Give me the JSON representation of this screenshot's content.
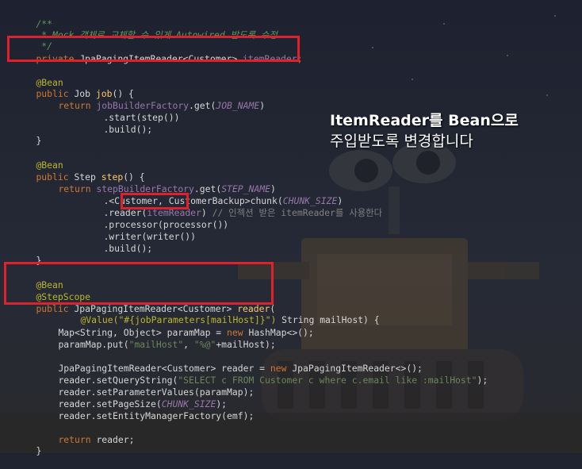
{
  "code": {
    "comment_open": "/**",
    "comment_body_star": " * ",
    "comment_body_text": "Mock 객체로 교체할 수 있게 Autowired 받도록 수정",
    "comment_close": " */",
    "field_private": "private",
    "field_type": " JpaPagingItemReader<Customer> ",
    "field_name": "itemReader",
    "field_semicolon": ";",
    "bean1": "@Bean",
    "job_public": "public",
    "job_type": " Job ",
    "job_name": "job",
    "job_rest": "() {",
    "job_return": "return",
    "job_factory": "jobBuilderFactory",
    "job_get": ".get(",
    "job_const": "JOB_NAME",
    "job_close": ")",
    "job_start": ".start(step())",
    "job_build": ".build();",
    "brace_close": "}",
    "bean2": "@Bean",
    "step_public": "public",
    "step_type": " Step ",
    "step_name": "step",
    "step_rest": "() {",
    "step_return": "return",
    "step_factory": "stepBuilderFactory",
    "step_get": ".get(",
    "step_const": "STEP_NAME",
    "step_close": ")",
    "step_chunk_a": ".<Customer, CustomerBackup>chunk(",
    "step_chunk_const": "CHUNK_SIZE",
    "step_chunk_b": ")",
    "step_reader_a": ".reader(",
    "step_reader_arg": "itemReader",
    "step_reader_b": ")",
    "step_reader_comment": " // 인젝션 받은 itemReader를 사용한다",
    "step_processor": ".processor(processor())",
    "step_writer": ".writer(writer())",
    "step_build": ".build();",
    "bean3": "@Bean",
    "stepscope": "@StepScope",
    "reader_public": "public",
    "reader_type": " JpaPagingItemReader<Customer> ",
    "reader_name": "reader",
    "reader_open": "(",
    "reader_value_ann": "@Value(\"#{jobParameters[mailHost]}\")",
    "reader_param": " String mailHost) {",
    "map_decl_a": "Map<String, Object> paramMap = ",
    "map_new": "new",
    "map_decl_b": " HashMap<>();",
    "map_put_a": "paramMap.put(",
    "map_put_s1": "\"mailHost\"",
    "map_put_comma": ", ",
    "map_put_s2": "\"%@\"",
    "map_put_b": "+mailHost);",
    "rd_decl_a": "JpaPagingItemReader<Customer> reader = ",
    "rd_new": "new",
    "rd_decl_b": " JpaPagingItemReader<>();",
    "rd_query_a": "reader.setQueryString(",
    "rd_query_s": "\"SELECT c FROM Customer c where c.email like :mailHost\"",
    "rd_query_b": ");",
    "rd_params": "reader.setParameterValues(paramMap);",
    "rd_page_a": "reader.setPageSize(",
    "rd_page_const": "CHUNK_SIZE",
    "rd_page_b": ");",
    "rd_emf": "reader.setEntityManagerFactory(emf);",
    "ret_kw": "return",
    "ret_rest": " reader;",
    "final_brace": "}"
  },
  "annotation": {
    "line1": "ItemReader를 Bean으로",
    "line2": "주입받도록 변경합니다"
  },
  "colors": {
    "highlight_box": "#e0202a",
    "background": "#202430"
  }
}
